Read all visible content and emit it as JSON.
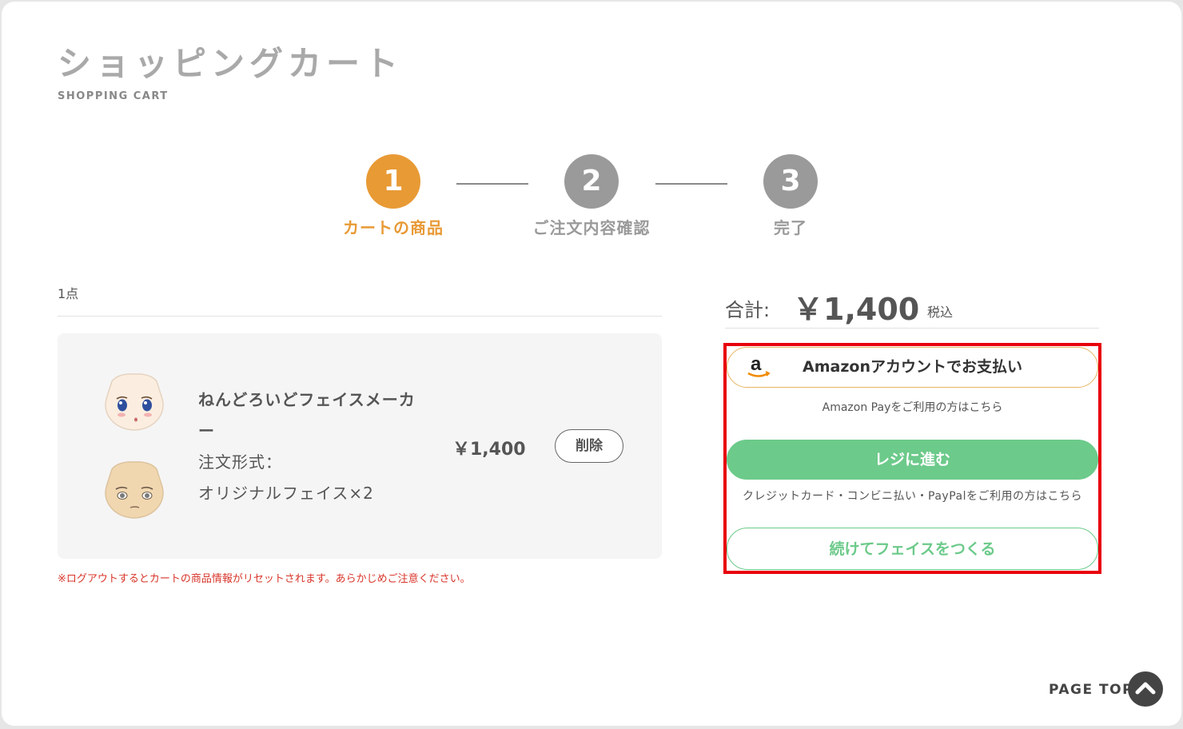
{
  "header": {
    "title": "ショッピングカート",
    "subtitle": "SHOPPING CART"
  },
  "steps": [
    {
      "number": "1",
      "label": "カートの商品",
      "active": true
    },
    {
      "number": "2",
      "label": "ご注文内容確認",
      "active": false
    },
    {
      "number": "3",
      "label": "完了",
      "active": false
    }
  ],
  "cart": {
    "count_label": "1点",
    "items": [
      {
        "name": "ねんどろいどフェイスメーカー",
        "format_label": "注文形式：",
        "format_value": "オリジナルフェイス×2",
        "price": "￥1,400",
        "delete_label": "削除"
      }
    ],
    "notice": "※ログアウトするとカートの商品情報がリセットされます。あらかじめご注意ください。"
  },
  "summary": {
    "total_label": "合計:",
    "total_amount": "￥1,400",
    "tax_label": "税込",
    "amazon_button_label": "Amazonアカウントでお支払い",
    "amazon_logo_icon": "amazon-logo-icon",
    "amazon_note": "Amazon Payをご利用の方はこちら",
    "checkout_button_label": "レジに進む",
    "checkout_note": "クレジットカード・コンビニ払い・PayPalをご利用の方はこちら",
    "continue_button_label": "続けてフェイスをつくる"
  },
  "footer": {
    "page_top_label": "PAGE TOP",
    "page_top_icon": "chevron-up-icon"
  },
  "colors": {
    "accent_orange": "#e89a35",
    "step_inactive": "#9a9a9a",
    "checkout_green": "#6cca8a",
    "notice_red": "#d8352a",
    "highlight_red": "#e8000c"
  }
}
